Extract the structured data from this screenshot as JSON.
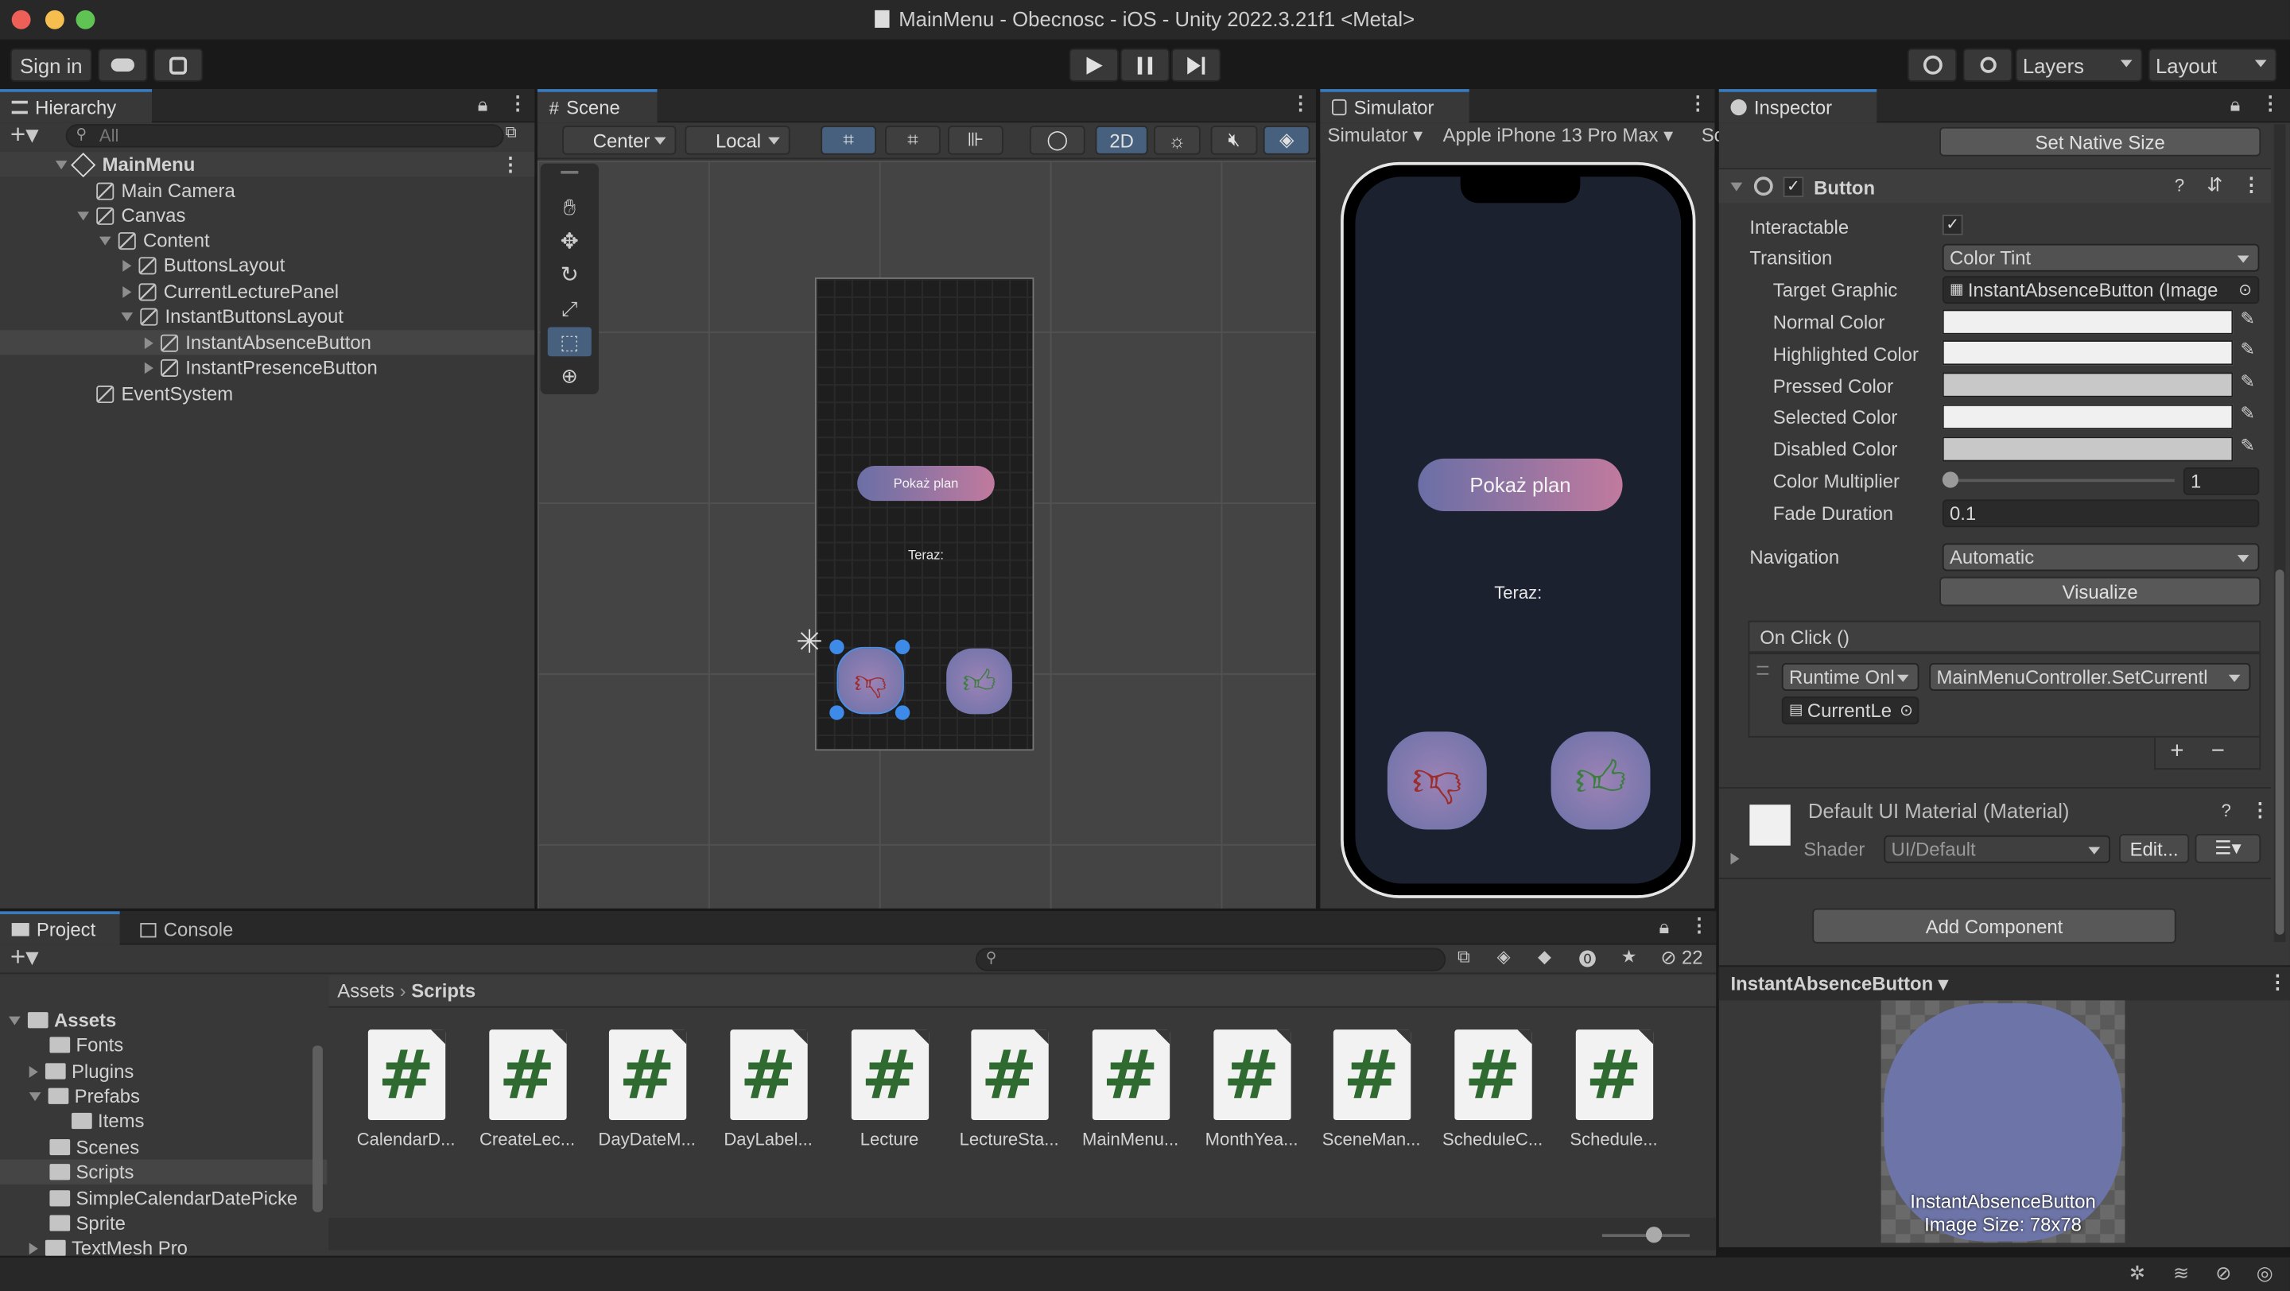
{
  "window": {
    "title": "MainMenu - Obecnosc - iOS - Unity 2022.3.21f1 <Metal>"
  },
  "toolbar": {
    "sign_in": "Sign in",
    "layers": "Layers",
    "layout": "Layout"
  },
  "hierarchy": {
    "tab": "Hierarchy",
    "search_placeholder": "All",
    "items": [
      {
        "label": "MainMenu"
      },
      {
        "label": "Main Camera"
      },
      {
        "label": "Canvas"
      },
      {
        "label": "Content"
      },
      {
        "label": "ButtonsLayout"
      },
      {
        "label": "CurrentLecturePanel"
      },
      {
        "label": "InstantButtonsLayout"
      },
      {
        "label": "InstantAbsenceButton"
      },
      {
        "label": "InstantPresenceButton"
      },
      {
        "label": "EventSystem"
      }
    ]
  },
  "scene": {
    "tab": "Scene",
    "pivot": "Center",
    "space": "Local",
    "mode_2d": "2D",
    "button_label": "Pokaż plan",
    "now_label": "Teraz:"
  },
  "simulator": {
    "tab": "Simulator",
    "mode": "Simulator",
    "device": "Apple iPhone 13 Pro Max",
    "cut": "Sc",
    "button_label": "Pokaż plan",
    "now_label": "Teraz:"
  },
  "inspector": {
    "tab": "Inspector",
    "set_native_size": "Set Native Size",
    "component": "Button",
    "rows": {
      "interactable": "Interactable",
      "transition": "Transition",
      "transition_value": "Color Tint",
      "target_graphic": "Target Graphic",
      "target_graphic_value": "InstantAbsenceButton (Image",
      "normal_color": "Normal Color",
      "highlighted_color": "Highlighted Color",
      "pressed_color": "Pressed Color",
      "selected_color": "Selected Color",
      "disabled_color": "Disabled Color",
      "color_multiplier": "Color Multiplier",
      "color_multiplier_value": "1",
      "fade_duration": "Fade Duration",
      "fade_duration_value": "0.1",
      "navigation": "Navigation",
      "navigation_value": "Automatic",
      "visualize": "Visualize"
    },
    "on_click": {
      "header": "On Click ()",
      "runtime": "Runtime Onl",
      "method": "MainMenuController.SetCurrentl",
      "object": "CurrentLe"
    },
    "material": {
      "name": "Default UI Material (Material)",
      "shader_label": "Shader",
      "shader_value": "UI/Default",
      "edit": "Edit..."
    },
    "add_component": "Add Component",
    "preview": {
      "title": "InstantAbsenceButton",
      "caption_1": "InstantAbsenceButton",
      "caption_2": "Image Size: 78x78"
    }
  },
  "project": {
    "tab_project": "Project",
    "tab_console": "Console",
    "hidden_count": "22",
    "tree": [
      {
        "label": "Assets"
      },
      {
        "label": "Fonts"
      },
      {
        "label": "Plugins"
      },
      {
        "label": "Prefabs"
      },
      {
        "label": "Items"
      },
      {
        "label": "Scenes"
      },
      {
        "label": "Scripts"
      },
      {
        "label": "SimpleCalendarDatePicke"
      },
      {
        "label": "Sprite"
      },
      {
        "label": "TextMesh Pro"
      }
    ],
    "breadcrumb": {
      "root": "Assets",
      "current": "Scripts"
    },
    "assets": [
      {
        "label": "CalendarD..."
      },
      {
        "label": "CreateLec..."
      },
      {
        "label": "DayDateM..."
      },
      {
        "label": "DayLabel..."
      },
      {
        "label": "Lecture"
      },
      {
        "label": "LectureSta..."
      },
      {
        "label": "MainMenu..."
      },
      {
        "label": "MonthYea..."
      },
      {
        "label": "SceneMan..."
      },
      {
        "label": "ScheduleC..."
      },
      {
        "label": "Schedule..."
      }
    ]
  },
  "colors": {
    "accent": "#3a79bb",
    "selection": "#454545",
    "panel": "#383838"
  }
}
